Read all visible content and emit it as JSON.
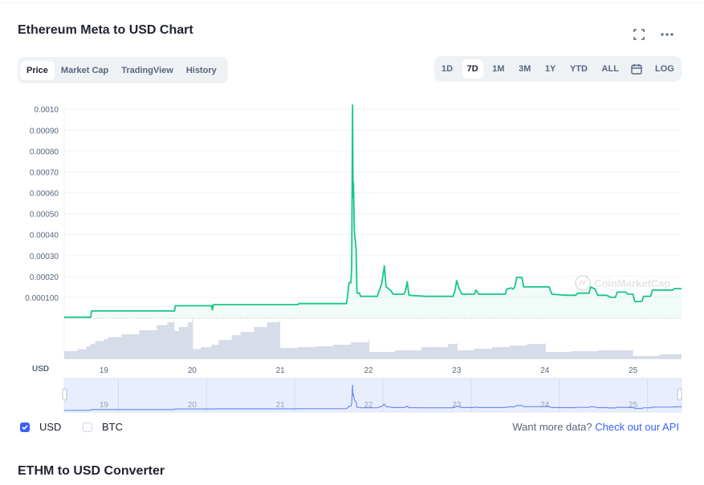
{
  "header": {
    "title": "Ethereum Meta to USD Chart",
    "fullscreen_icon": "fullscreen-icon",
    "more_icon": "more-horizontal-icon"
  },
  "tabs": [
    {
      "label": "Price",
      "active": true
    },
    {
      "label": "Market Cap",
      "active": false
    },
    {
      "label": "TradingView",
      "active": false
    },
    {
      "label": "History",
      "active": false
    }
  ],
  "ranges": [
    {
      "label": "1D",
      "active": false
    },
    {
      "label": "7D",
      "active": true
    },
    {
      "label": "1M",
      "active": false
    },
    {
      "label": "3M",
      "active": false
    },
    {
      "label": "1Y",
      "active": false
    },
    {
      "label": "YTD",
      "active": false
    },
    {
      "label": "ALL",
      "active": false
    }
  ],
  "calendar_icon": "calendar-icon",
  "log_label": "LOG",
  "watermark": "CoinMarketCap",
  "currency_axis_label": "USD",
  "colors": {
    "line": "#16c784",
    "volume": "#cfd6e4",
    "navigator_line": "#6b8cf5",
    "navigator_bg": "#e8eefe",
    "accent": "#3861fb"
  },
  "legend": {
    "usd": {
      "label": "USD",
      "checked": true
    },
    "btc": {
      "label": "BTC",
      "checked": false
    }
  },
  "footer": {
    "more_data_text": "Want more data?",
    "api_link": "Check out our API"
  },
  "converter_title": "ETHM to USD Converter",
  "chart_data": {
    "type": "line",
    "title": "",
    "xlabel": "",
    "ylabel": "",
    "y_tick_labels": [
      "0.0010",
      "0.00090",
      "0.00080",
      "0.00070",
      "0.00060",
      "0.00050",
      "0.00040",
      "0.00030",
      "0.00020",
      "0.000100"
    ],
    "y_tick_values": [
      0.001,
      0.0009,
      0.0008,
      0.0007,
      0.0006,
      0.0005,
      0.0004,
      0.0003,
      0.0002,
      0.0001
    ],
    "ylim": [
      0.0,
      0.00102
    ],
    "xlim": [
      18.55,
      25.55
    ],
    "x_ticks": [
      19,
      20,
      21,
      22,
      23,
      24,
      25
    ],
    "x_tick_labels": [
      "19",
      "20",
      "21",
      "22",
      "23",
      "24",
      "25"
    ],
    "grid": true,
    "series": [
      {
        "points": [
          [
            18.55,
            5e-06
          ],
          [
            18.85,
            5e-06
          ],
          [
            18.86,
            3.5e-05
          ],
          [
            19.8,
            3.5e-05
          ],
          [
            19.81,
            6e-05
          ],
          [
            20.22,
            6e-05
          ],
          [
            20.23,
            4e-05
          ],
          [
            20.24,
            6.5e-05
          ],
          [
            21.2,
            6.5e-05
          ],
          [
            21.21,
            7e-05
          ],
          [
            21.75,
            7e-05
          ],
          [
            21.76,
            9.5e-05
          ],
          [
            21.78,
            0.00017
          ],
          [
            21.8,
            0.00017
          ],
          [
            21.81,
            0.00024
          ],
          [
            21.82,
            0.00102
          ],
          [
            21.825,
            0.00058
          ],
          [
            21.83,
            0.00065
          ],
          [
            21.84,
            0.00042
          ],
          [
            21.86,
            0.00033
          ],
          [
            21.87,
            0.00012
          ],
          [
            21.9,
            0.00012
          ],
          [
            21.91,
            0.000105
          ],
          [
            22.1,
            0.000105
          ],
          [
            22.15,
            0.000165
          ],
          [
            22.18,
            0.00025
          ],
          [
            22.2,
            0.00015
          ],
          [
            22.25,
            0.000135
          ],
          [
            22.28,
            0.000115
          ],
          [
            22.4,
            0.000115
          ],
          [
            22.42,
            0.00013
          ],
          [
            22.44,
            0.000175
          ],
          [
            22.46,
            0.00011
          ],
          [
            22.65,
            0.000105
          ],
          [
            22.96,
            0.000105
          ],
          [
            22.98,
            0.00013
          ],
          [
            23.0,
            0.00018
          ],
          [
            23.03,
            0.00014
          ],
          [
            23.06,
            0.000115
          ],
          [
            23.2,
            0.000115
          ],
          [
            23.22,
            0.000135
          ],
          [
            23.25,
            0.000115
          ],
          [
            23.55,
            0.000115
          ],
          [
            23.57,
            0.00014
          ],
          [
            23.62,
            0.000145
          ],
          [
            23.64,
            0.00014
          ],
          [
            23.66,
            0.00015
          ],
          [
            23.68,
            0.000195
          ],
          [
            23.74,
            0.000195
          ],
          [
            23.76,
            0.00015
          ],
          [
            24.05,
            0.00015
          ],
          [
            24.08,
            0.000115
          ],
          [
            24.25,
            0.00011
          ],
          [
            24.35,
            0.00011
          ],
          [
            24.37,
            0.00012
          ],
          [
            24.5,
            0.00012
          ],
          [
            24.52,
            0.00015
          ],
          [
            24.57,
            0.00014
          ],
          [
            24.6,
            0.00011
          ],
          [
            24.68,
            0.00011
          ],
          [
            24.7,
            0.00011
          ],
          [
            24.75,
            0.0001
          ],
          [
            24.8,
            0.0001
          ],
          [
            24.82,
            0.000125
          ],
          [
            24.92,
            0.000125
          ],
          [
            24.94,
            0.000115
          ],
          [
            25.0,
            0.000115
          ],
          [
            25.02,
            8e-05
          ],
          [
            25.1,
            8e-05
          ],
          [
            25.12,
            0.000105
          ],
          [
            25.2,
            0.000105
          ],
          [
            25.22,
            0.000135
          ],
          [
            25.45,
            0.000135
          ],
          [
            25.47,
            0.000142
          ],
          [
            25.55,
            0.000142
          ]
        ]
      }
    ],
    "volume": {
      "ylim": [
        0,
        1.0
      ],
      "points": [
        [
          18.55,
          0.2
        ],
        [
          18.7,
          0.25
        ],
        [
          18.8,
          0.32
        ],
        [
          18.85,
          0.38
        ],
        [
          18.9,
          0.45
        ],
        [
          19.0,
          0.5
        ],
        [
          19.05,
          0.55
        ],
        [
          19.2,
          0.62
        ],
        [
          19.4,
          0.72
        ],
        [
          19.6,
          0.85
        ],
        [
          19.72,
          0.92
        ],
        [
          19.79,
          0.95
        ],
        [
          19.8,
          0.7
        ],
        [
          19.85,
          0.8
        ],
        [
          19.95,
          0.92
        ],
        [
          20.0,
          1.0
        ],
        [
          20.01,
          0.25
        ],
        [
          20.1,
          0.3
        ],
        [
          20.22,
          0.36
        ],
        [
          20.3,
          0.48
        ],
        [
          20.45,
          0.6
        ],
        [
          20.55,
          0.68
        ],
        [
          20.7,
          0.8
        ],
        [
          20.85,
          0.92
        ],
        [
          20.99,
          0.95
        ],
        [
          21.0,
          0.28
        ],
        [
          21.2,
          0.3
        ],
        [
          21.4,
          0.32
        ],
        [
          21.6,
          0.36
        ],
        [
          21.8,
          0.42
        ],
        [
          22.0,
          0.48
        ],
        [
          22.01,
          0.18
        ],
        [
          22.3,
          0.22
        ],
        [
          22.6,
          0.3
        ],
        [
          22.9,
          0.38
        ],
        [
          23.0,
          0.4
        ],
        [
          23.01,
          0.22
        ],
        [
          23.2,
          0.26
        ],
        [
          23.4,
          0.3
        ],
        [
          23.6,
          0.34
        ],
        [
          23.8,
          0.38
        ],
        [
          24.0,
          0.4
        ],
        [
          24.01,
          0.18
        ],
        [
          24.3,
          0.2
        ],
        [
          24.6,
          0.22
        ],
        [
          24.99,
          0.25
        ],
        [
          25.0,
          0.08
        ],
        [
          25.3,
          0.12
        ],
        [
          25.55,
          0.15
        ]
      ]
    }
  }
}
